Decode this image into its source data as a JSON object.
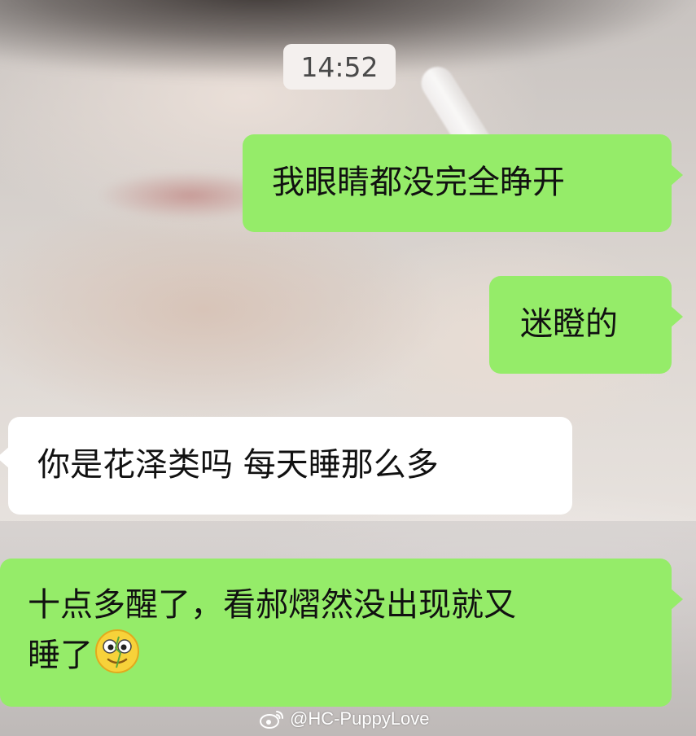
{
  "timestamp": "14:52",
  "messages": [
    {
      "side": "me",
      "text": "我眼睛都没完全睁开"
    },
    {
      "side": "me",
      "text": "迷瞪的"
    },
    {
      "side": "other",
      "text": "你是花泽类吗 每天睡那么多"
    },
    {
      "side": "me",
      "line1": "十点多醒了，看郝熠然没出现就又",
      "line2": "睡了",
      "emoji": "zipper-mouth-dizzy-face-emoji"
    }
  ],
  "watermark": {
    "icon": "weibo-icon",
    "handle": "@HC-PuppyLove"
  },
  "colors": {
    "my_bubble": "#95ec69",
    "other_bubble": "#ffffff",
    "timestamp_bg": "#f4f0ee"
  }
}
